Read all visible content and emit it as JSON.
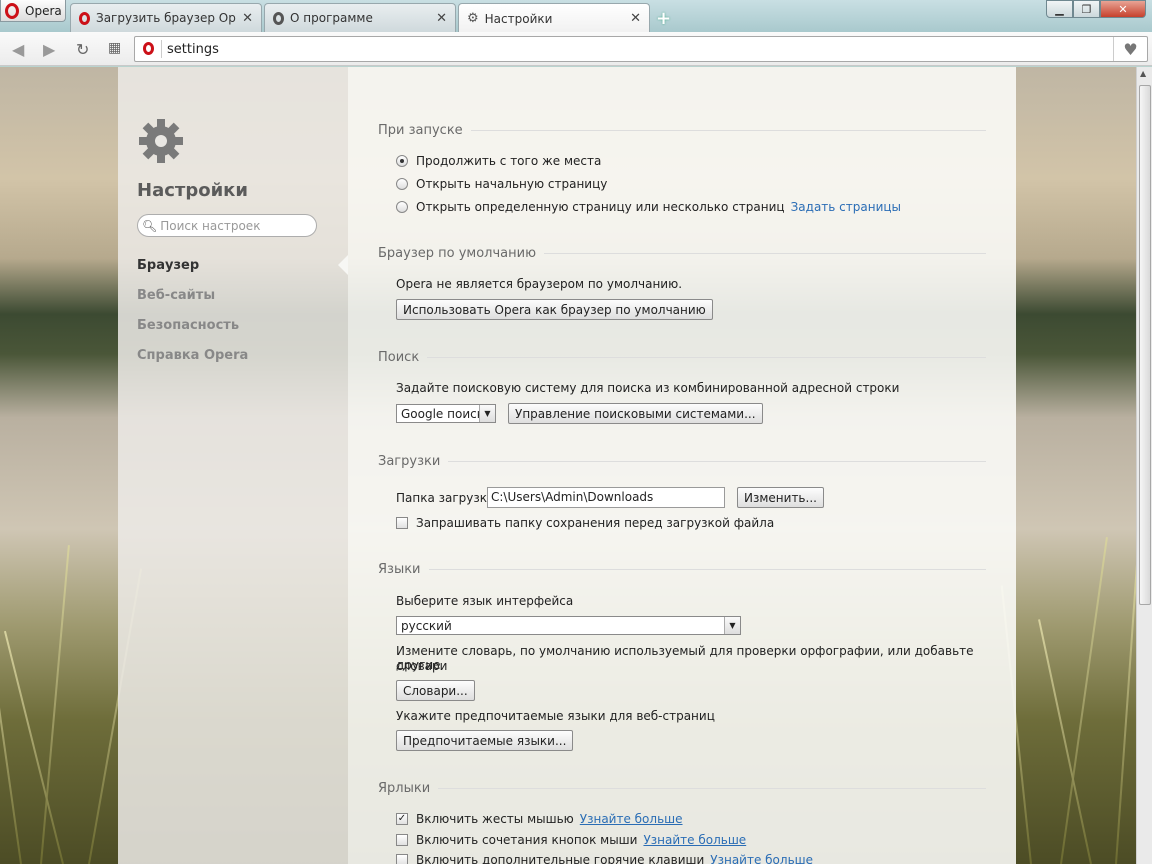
{
  "browser": {
    "menu_label": "Opera",
    "tabs": [
      {
        "title": "Загрузить браузер Opera"
      },
      {
        "title": "О программе"
      },
      {
        "title": "Настройки"
      }
    ],
    "new_tab_symbol": "+",
    "address": "settings"
  },
  "sidebar": {
    "title": "Настройки",
    "search_placeholder": "Поиск настроек",
    "items": [
      {
        "label": "Браузер"
      },
      {
        "label": "Веб-сайты"
      },
      {
        "label": "Безопасность"
      },
      {
        "label": "Справка Opera"
      }
    ]
  },
  "startup": {
    "title": "При запуске",
    "opt1": "Продолжить с того же места",
    "opt2": "Открыть начальную страницу",
    "opt3": "Открыть определенную страницу или несколько страниц",
    "set_pages_link": "Задать страницы"
  },
  "default_browser": {
    "title": "Браузер по умолчанию",
    "status": "Opera не является браузером по умолчанию.",
    "button": "Использовать Opera как браузер по умолчанию"
  },
  "search": {
    "title": "Поиск",
    "description": "Задайте поисковую систему для поиска из комбинированной адресной строки",
    "engine": "Google поиск",
    "manage_button": "Управление поисковыми системами..."
  },
  "downloads": {
    "title": "Загрузки",
    "folder_label": "Папка загрузки:",
    "folder_value": "C:\\Users\\Admin\\Downloads",
    "change_button": "Изменить...",
    "ask_label": "Запрашивать папку сохранения перед загрузкой файла"
  },
  "languages": {
    "title": "Языки",
    "ui_label": "Выберите язык интерфейса",
    "ui_value": "русский",
    "dict_desc_1": "Измените словарь, по умолчанию используемый для проверки орфографии, или добавьте другие",
    "dict_desc_2": "словари",
    "dict_button": "Словари...",
    "pref_desc": "Укажите предпочитаемые языки для веб-страниц",
    "pref_button": "Предпочитаемые языки..."
  },
  "shortcuts": {
    "title": "Ярлыки",
    "mouse_gestures": "Включить жесты мышью",
    "mouse_buttons": "Включить сочетания кнопок мыши",
    "hotkeys": "Включить дополнительные горячие клавиши",
    "learn_more": "Узнайте больше"
  }
}
